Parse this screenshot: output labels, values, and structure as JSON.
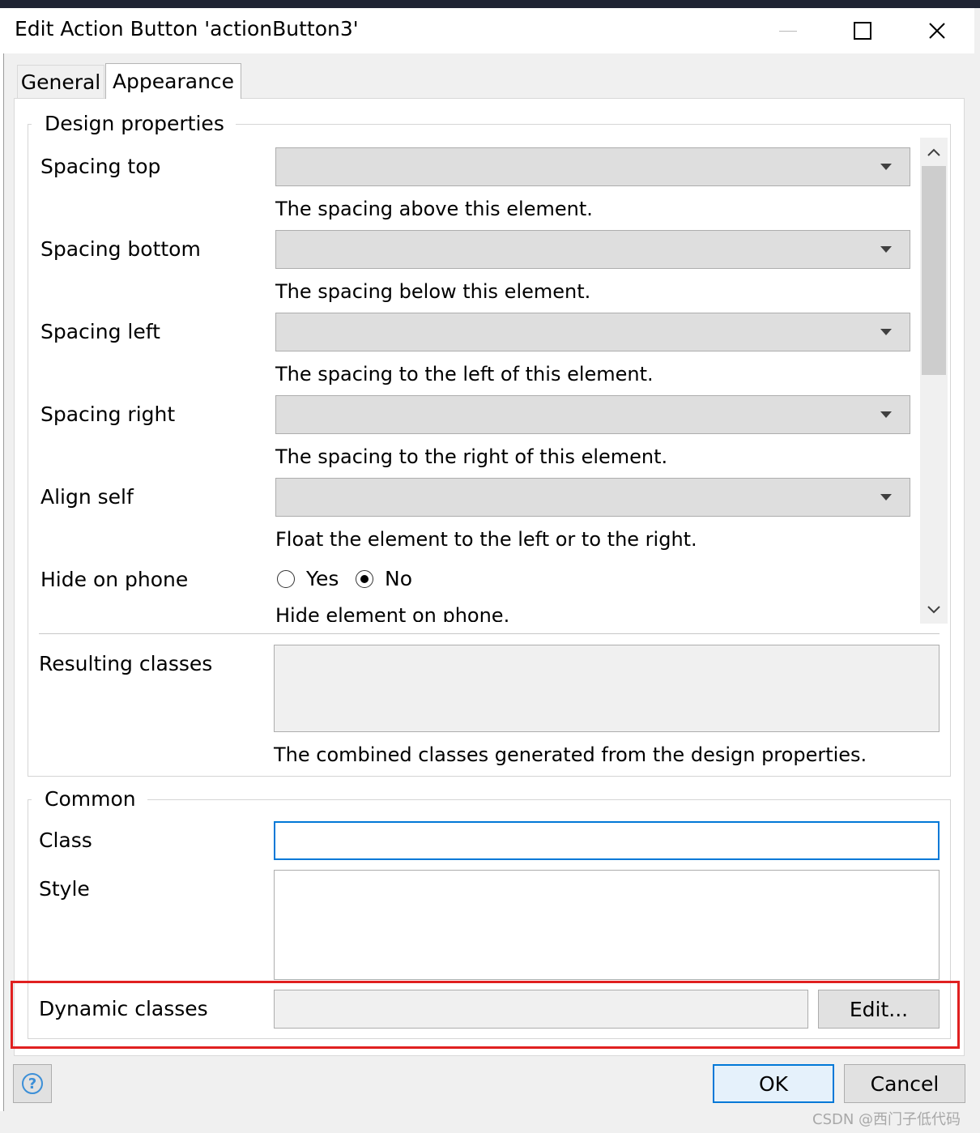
{
  "window": {
    "title": "Edit Action Button 'actionButton3'",
    "minimize_icon": "minimize-icon",
    "maximize_icon": "maximize-icon",
    "close_icon": "close-icon",
    "close_glyph": "✕"
  },
  "tabs": [
    {
      "label": "General",
      "selected": false
    },
    {
      "label": "Appearance",
      "selected": true
    }
  ],
  "design_properties": {
    "title": "Design properties",
    "rows": [
      {
        "label": "Spacing top",
        "value": "",
        "description": "The spacing above this element."
      },
      {
        "label": "Spacing bottom",
        "value": "",
        "description": "The spacing below this element."
      },
      {
        "label": "Spacing left",
        "value": "",
        "description": "The spacing to the left of this element."
      },
      {
        "label": "Spacing right",
        "value": "",
        "description": "The spacing to the right of this element."
      },
      {
        "label": "Align self",
        "value": "",
        "description": "Float the element to the left or to the right."
      }
    ],
    "hide_on_phone": {
      "label": "Hide on phone",
      "options": [
        "Yes",
        "No"
      ],
      "selected": "No",
      "description": "Hide element on phone."
    },
    "scroll_up_glyph": "︿",
    "scroll_down_glyph": "﹀",
    "resulting_classes": {
      "label": "Resulting classes",
      "value": "",
      "description": "The combined classes generated from the design properties."
    }
  },
  "common": {
    "title": "Common",
    "class_label": "Class",
    "class_value": "",
    "style_label": "Style",
    "style_value": "",
    "dynamic_classes_label": "Dynamic classes",
    "dynamic_classes_value": "",
    "edit_button": "Edit..."
  },
  "footer": {
    "help_glyph": "?",
    "ok_label": "OK",
    "cancel_label": "Cancel"
  },
  "watermark": "CSDN @西门子低代码",
  "colors": {
    "highlight": "#e02020",
    "focus": "#0078d7",
    "dialog_bg": "#f0f0f0"
  }
}
